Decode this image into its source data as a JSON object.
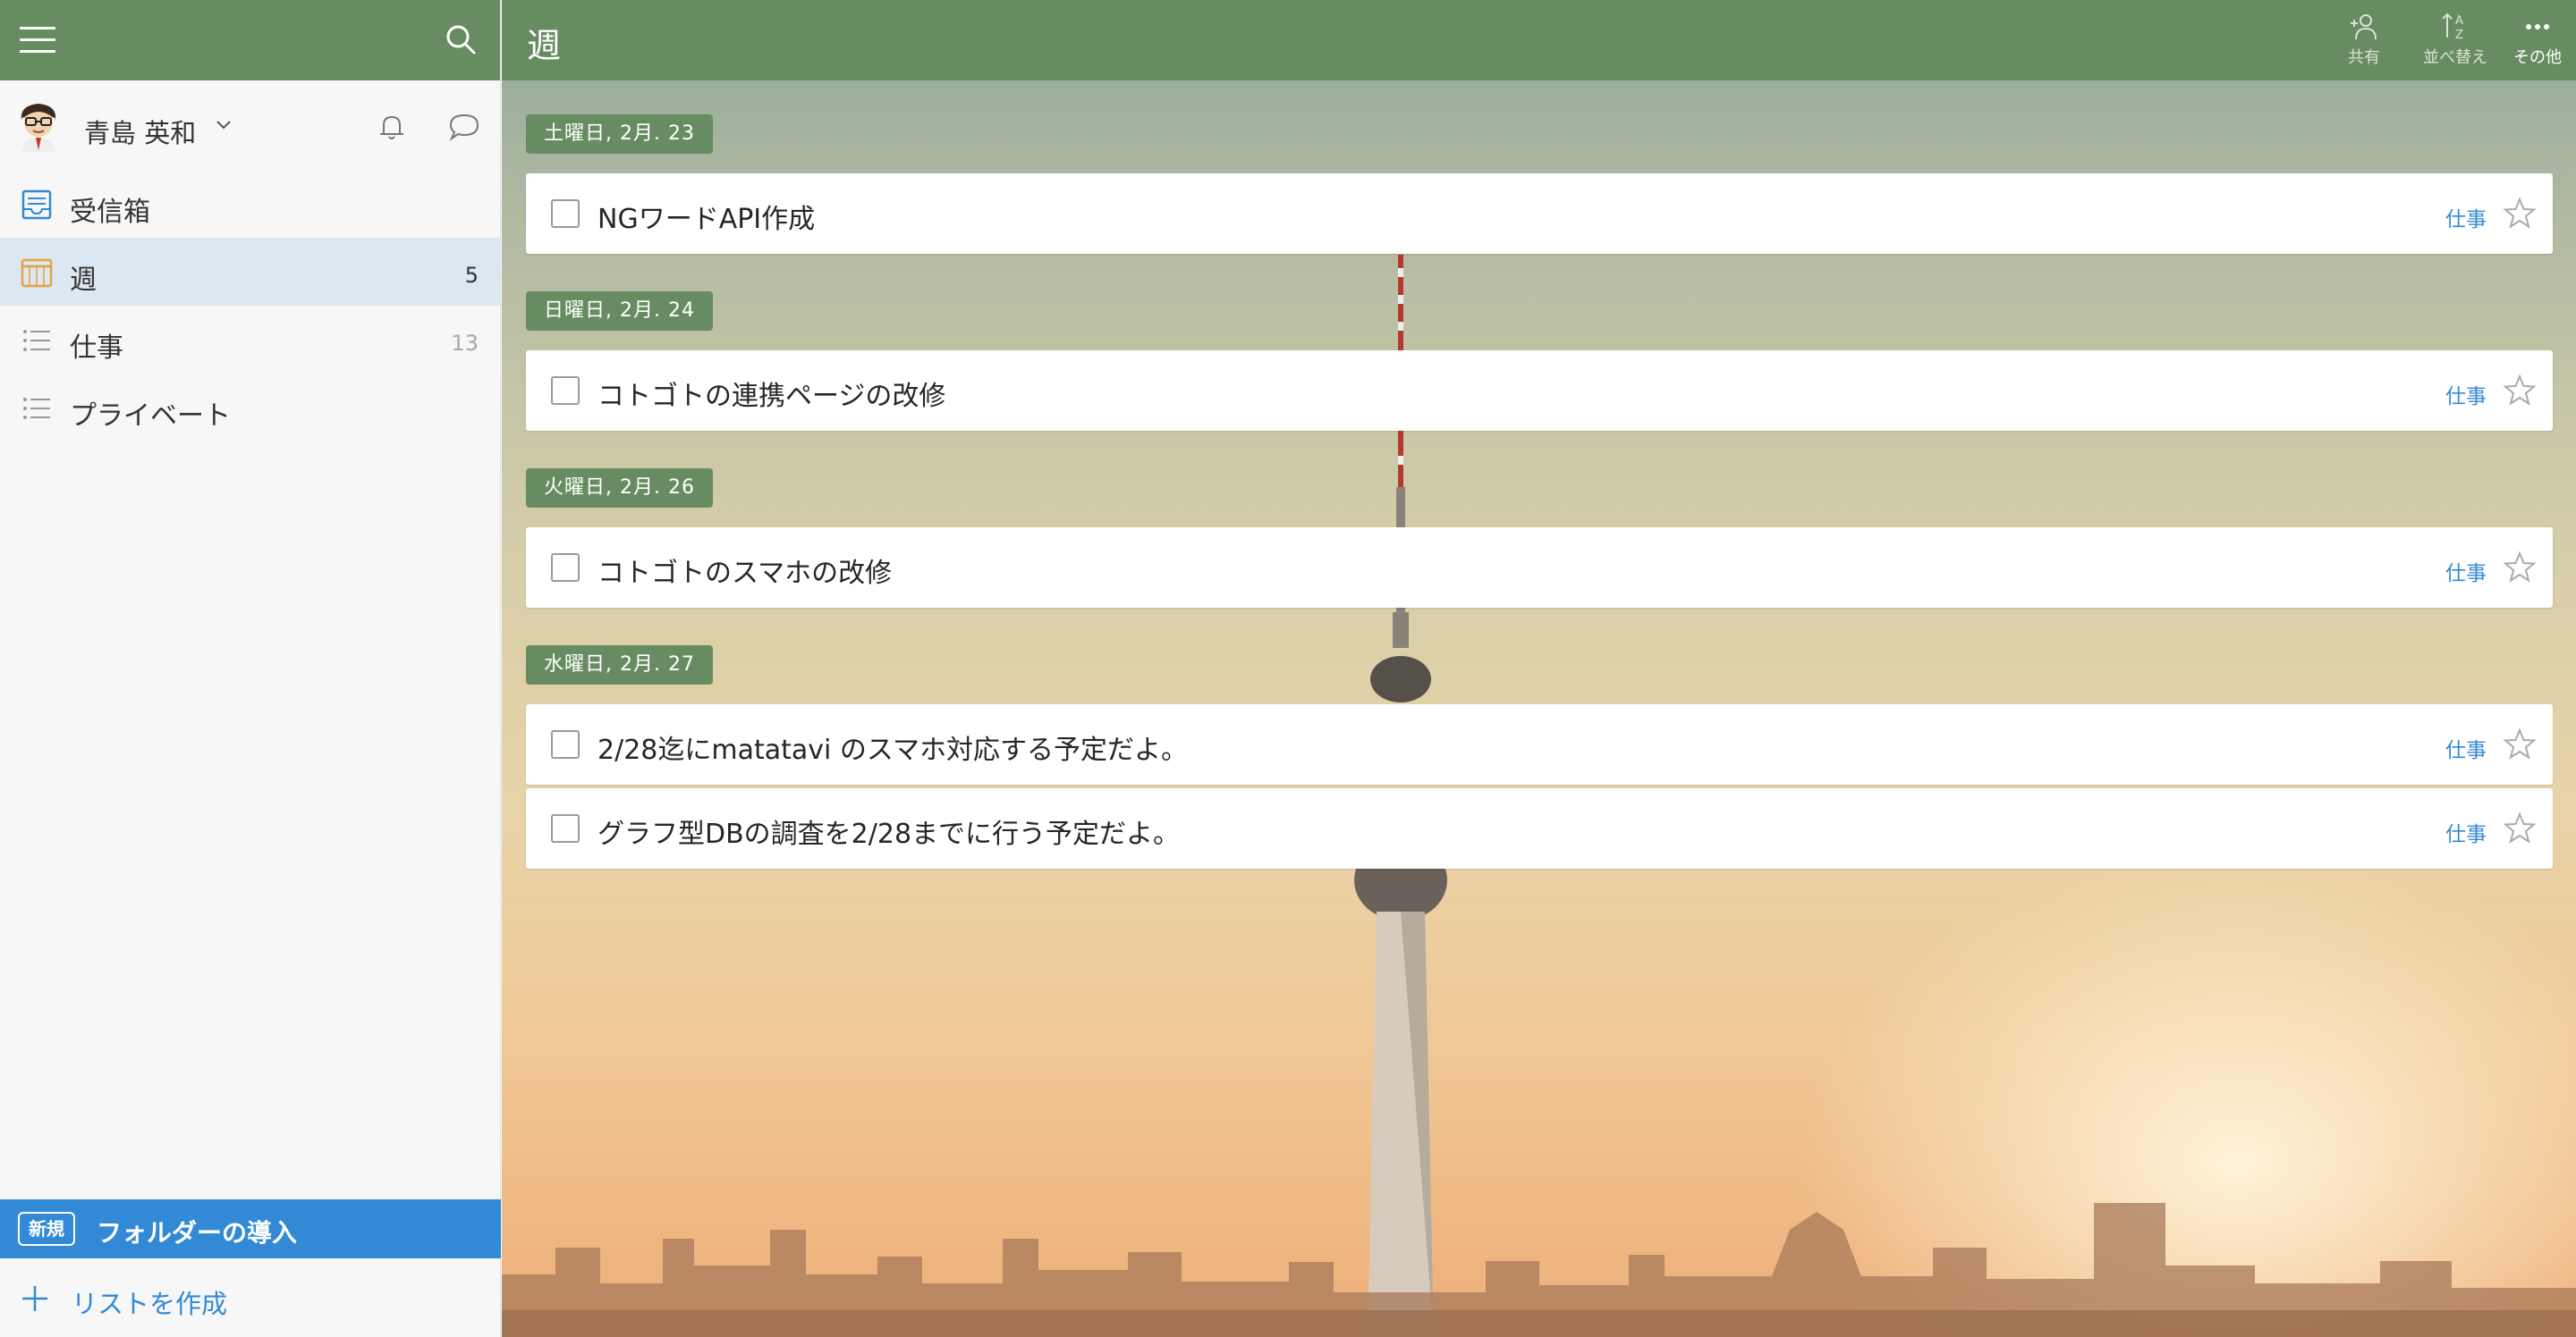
{
  "colors": {
    "header_green": "#678c62",
    "accent_blue": "#328ad6",
    "active_bg": "#dbe7f1"
  },
  "sidebar": {
    "user": {
      "name": "青島 英和"
    },
    "items": [
      {
        "label": "受信箱",
        "count": "",
        "icon": "inbox-icon",
        "active": false
      },
      {
        "label": "週",
        "count": "5",
        "icon": "calendar-week-icon",
        "active": true
      },
      {
        "label": "仕事",
        "count": "13",
        "icon": "list-icon",
        "active": false
      },
      {
        "label": "プライベート",
        "count": "",
        "icon": "list-icon",
        "active": false
      }
    ],
    "new_feature": {
      "badge": "新規",
      "label": "フォルダーの導入"
    },
    "create_list_label": "リストを作成"
  },
  "header": {
    "title": "週",
    "actions": [
      {
        "label": "共有",
        "icon": "share-person-icon"
      },
      {
        "label": "並べ替え",
        "icon": "sort-az-icon"
      },
      {
        "label": "その他",
        "icon": "more-dots-icon"
      }
    ]
  },
  "groups": [
    {
      "date": "土曜日, 2月. 23",
      "tasks": [
        {
          "title": "NGワードAPI作成",
          "list": "仕事"
        }
      ]
    },
    {
      "date": "日曜日, 2月. 24",
      "tasks": [
        {
          "title": "コトゴトの連携ページの改修",
          "list": "仕事"
        }
      ]
    },
    {
      "date": "火曜日, 2月. 26",
      "tasks": [
        {
          "title": "コトゴトのスマホの改修",
          "list": "仕事"
        }
      ]
    },
    {
      "date": "水曜日, 2月. 27",
      "tasks": [
        {
          "title": "2/28迄にmatatavi のスマホ対応する予定だよ。",
          "list": "仕事"
        },
        {
          "title": "グラフ型DBの調査を2/28までに行う予定だよ。",
          "list": "仕事"
        }
      ]
    }
  ]
}
